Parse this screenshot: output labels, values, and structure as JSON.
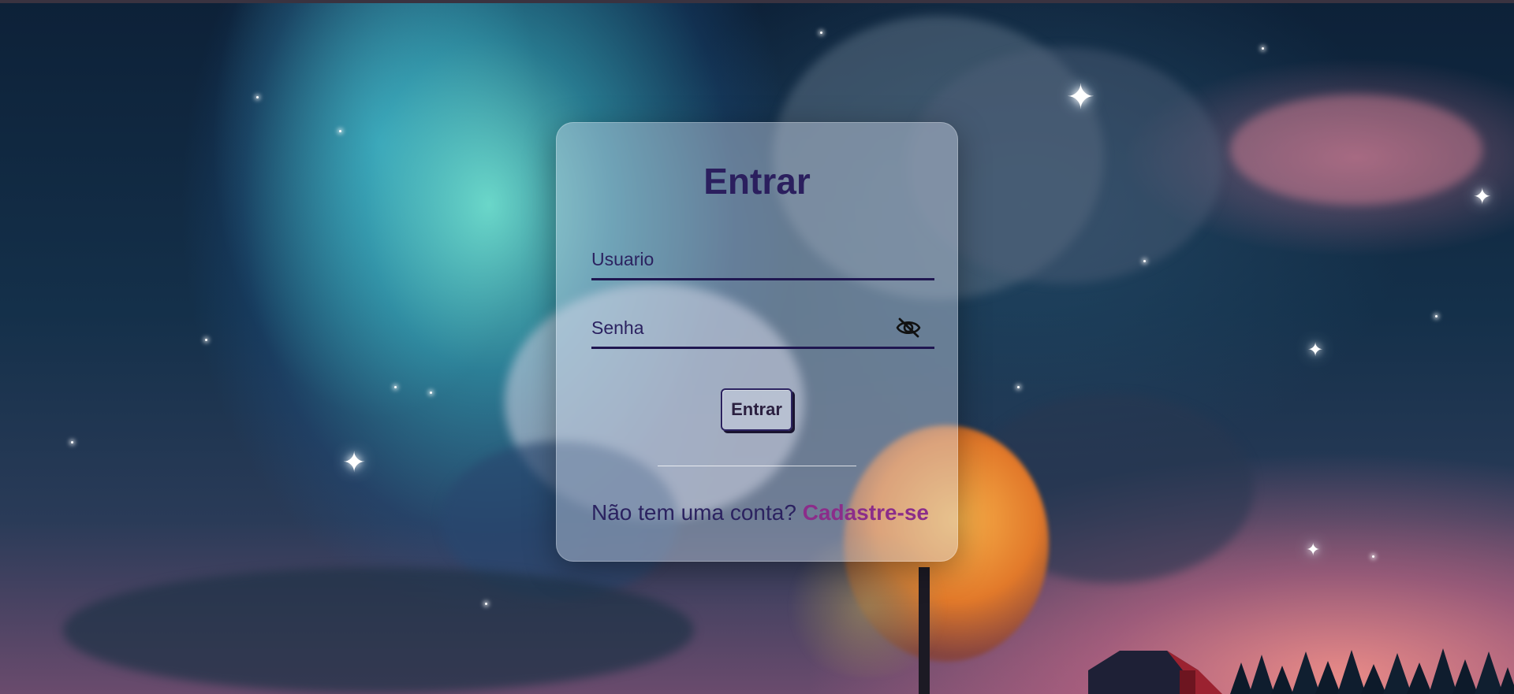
{
  "login": {
    "title": "Entrar",
    "username": {
      "value": "",
      "placeholder": "Usuario"
    },
    "password": {
      "value": "",
      "placeholder": "Senha"
    },
    "toggle_password_icon": "eye-slash-icon",
    "submit_label": "Entrar",
    "signup_prompt": "Não tem uma conta?",
    "signup_link": "Cadastre-se"
  },
  "colors": {
    "title": "#2b1f5e",
    "field_underline": "#1f1650",
    "link": "#8b2d8a",
    "card_background": "rgba(210,220,235,0.42)"
  }
}
